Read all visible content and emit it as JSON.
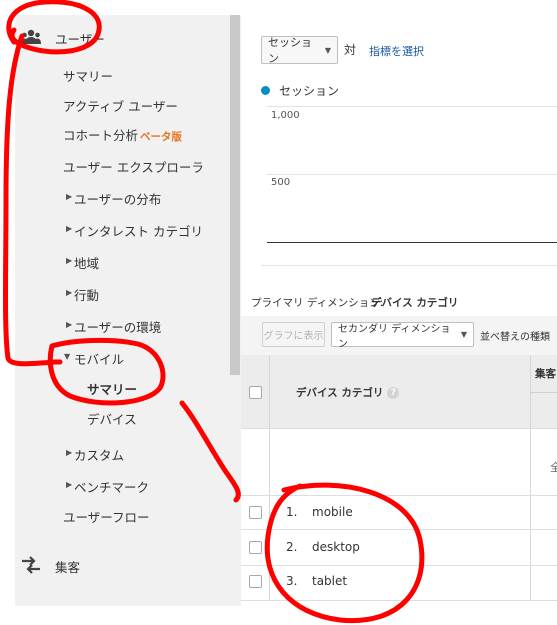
{
  "sidebar": {
    "users_section": {
      "label": "ユーザー",
      "icon": "users-icon"
    },
    "items": [
      {
        "label": "サマリー"
      },
      {
        "label": "アクティブ ユーザー"
      },
      {
        "label": "コホート分析",
        "badge": "ベータ版"
      },
      {
        "label": "ユーザー エクスプローラ"
      },
      {
        "label": "ユーザーの分布"
      },
      {
        "label": "インタレスト カテゴリ"
      },
      {
        "label": "地域"
      },
      {
        "label": "行動"
      },
      {
        "label": "ユーザーの環境"
      },
      {
        "label": "モバイル"
      },
      {
        "label": "サマリー"
      },
      {
        "label": "デバイス"
      },
      {
        "label": "カスタム"
      },
      {
        "label": "ベンチマーク"
      },
      {
        "label": "ユーザーフロー"
      }
    ],
    "acquisition_section": {
      "label": "集客",
      "icon": "acquisition-icon"
    }
  },
  "main": {
    "metric_select": "セッション",
    "vs_label": "対",
    "select_metric_link": "指標を選択",
    "legend_label": "セッション",
    "y_ticks": [
      "1,000",
      "500"
    ],
    "primary_dimension_label": "プライマリ ディメンション:",
    "primary_dimension_value": "デバイス カテゴリ",
    "graph_button": "グラフに表示",
    "secondary_dimension": "セカンダリ ディメンション",
    "sort_label": "並べ替えの種類",
    "table": {
      "col_device": "デバイス カテゴリ",
      "col_acquisition": "集客",
      "summary_cell": "全",
      "rows": [
        {
          "index": "1.",
          "name": "mobile"
        },
        {
          "index": "2.",
          "name": "desktop"
        },
        {
          "index": "3.",
          "name": "tablet"
        }
      ]
    }
  },
  "colors": {
    "accent": "#058dc7",
    "link": "#1a57a0",
    "beta": "#e8711d",
    "annotation": "#ff0000"
  }
}
